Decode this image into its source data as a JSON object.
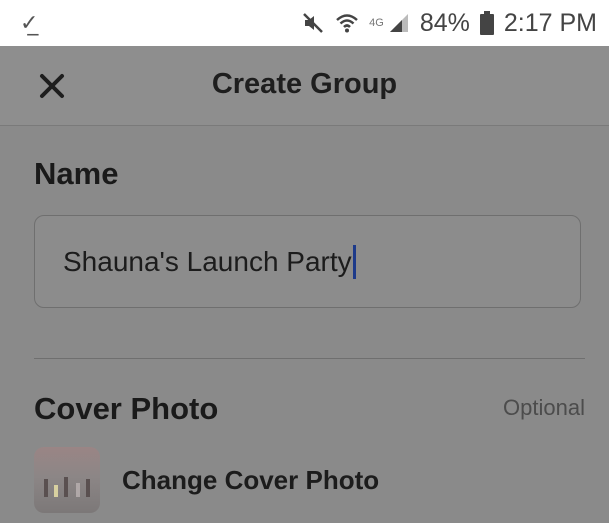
{
  "status_bar": {
    "network_tag": "4G",
    "battery": "84%",
    "time": "2:17 PM",
    "icons": [
      "download-check-icon",
      "mute-icon",
      "wifi-icon",
      "signal-icon",
      "battery-icon"
    ]
  },
  "header": {
    "title": "Create Group",
    "close_icon": "close-icon"
  },
  "name_section": {
    "title": "Name",
    "value": "Shauna's Launch Party"
  },
  "cover_section": {
    "title": "Cover Photo",
    "optional_label": "Optional",
    "change_label": "Change Cover Photo"
  }
}
